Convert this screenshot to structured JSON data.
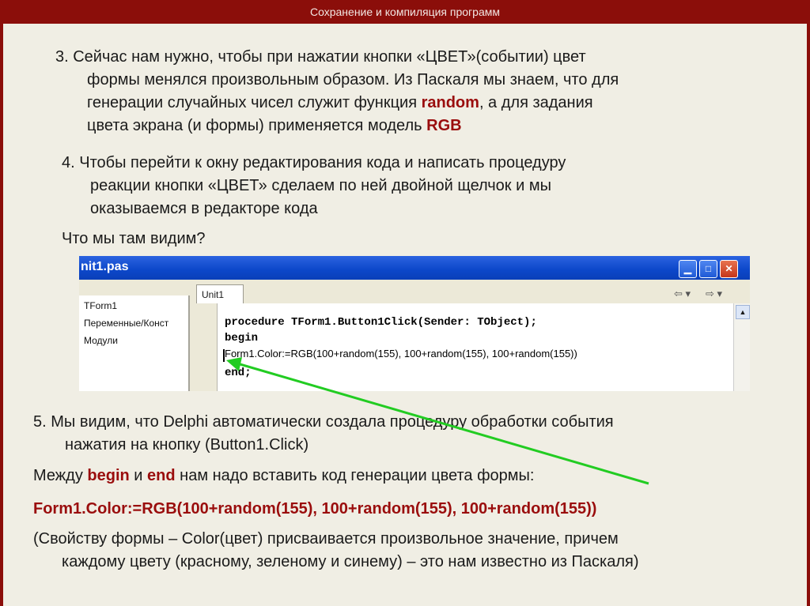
{
  "header": {
    "title": "Сохранение и компиляция программ"
  },
  "step3": {
    "line1": "3. Сейчас нам нужно, чтобы при нажатии кнопки «ЦВЕТ»(событии) цвет",
    "line2": "формы менялся произвольным образом. Из  Паскаля мы знаем, что для",
    "line3_a": "генерации случайных чисел служит функция ",
    "line3_b": "random",
    "line3_c": ", а для задания",
    "line4_a": "цвета экрана (и формы) применяется модель ",
    "line4_b": "RGB"
  },
  "step4": {
    "line1": "4. Чтобы перейти к окну редактирования кода и написать процедуру",
    "line2": "реакции кнопки «ЦВЕТ» сделаем по ней двойной щелчок и мы",
    "line3": "оказываемся в редакторе кода"
  },
  "question": "Что мы там видим?",
  "ide": {
    "window_title": "nit1.pas",
    "tab_label": "Unit1",
    "tree": [
      "TForm1",
      "Переменные/Конст",
      "Модули"
    ],
    "code_line1": "procedure TForm1.Button1Click(Sender: TObject);",
    "code_line2": "begin",
    "code_line3": "Form1.Color:=RGB(100+random(155), 100+random(155), 100+random(155))",
    "code_line4": "end;",
    "colors": {
      "title_bar": "#0c47c9",
      "arrow": "#22cc22"
    }
  },
  "step5": {
    "line1": "5.  Мы видим, что Delphi  автоматически создала процедуру обработки события",
    "line2": "нажатия на кнопку (Button1.Click)"
  },
  "between": {
    "a": "Между ",
    "b": "begin",
    "c": " и ",
    "d": "end",
    "e": " нам надо вставить код генерации цвета формы:"
  },
  "code_answer": "Form1.Color:=RGB(100+random(155), 100+random(155), 100+random(155))",
  "note": {
    "line1": "(Свойству формы  – Color(цвет) присваивается произвольное значение, причем",
    "line2": "каждому цвету (красному, зеленому и синему) – это нам известно из Паскаля)"
  }
}
